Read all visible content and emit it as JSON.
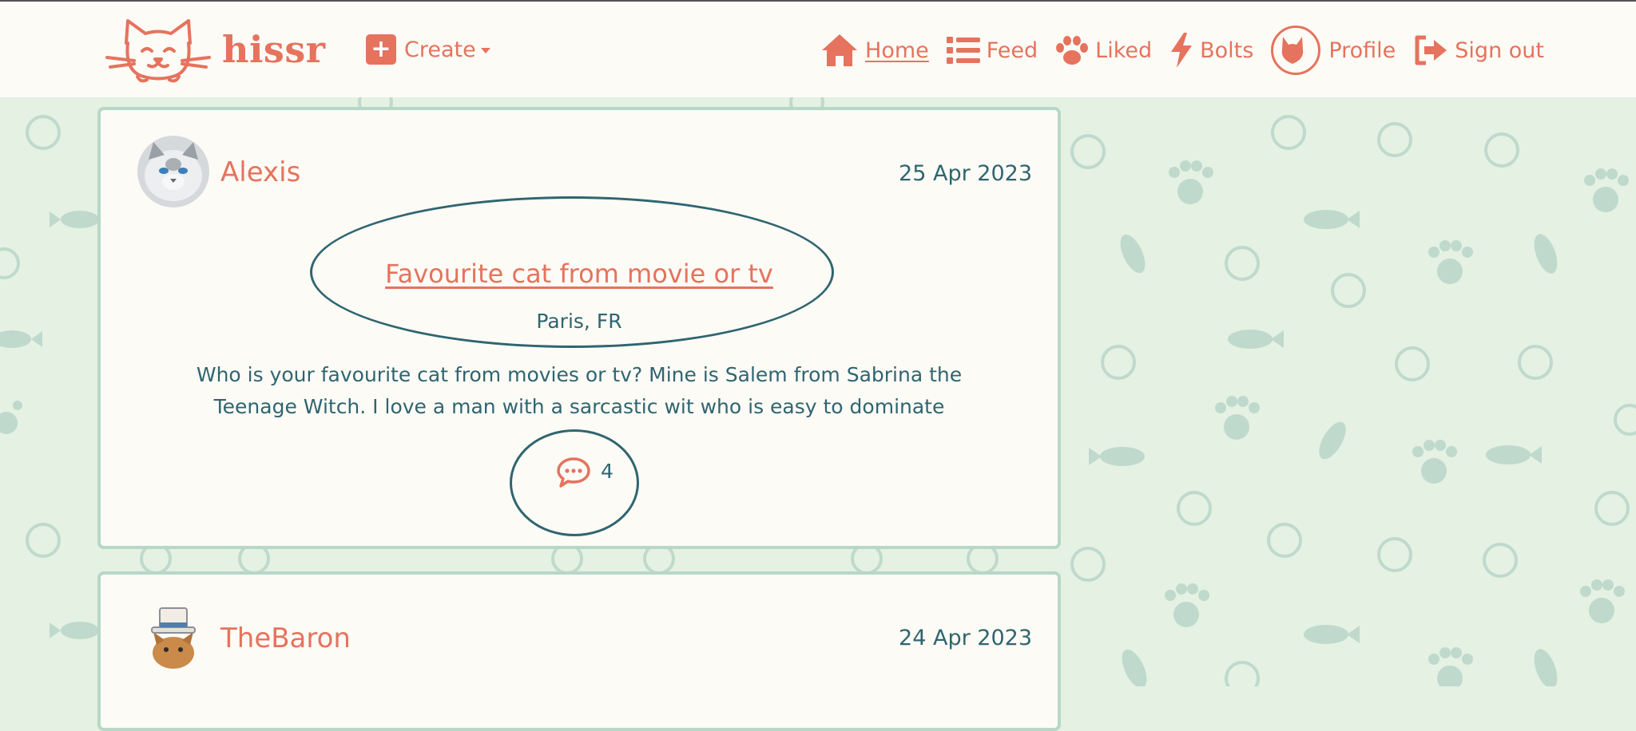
{
  "brand": {
    "name": "hissr",
    "logo_icon": "cat-face-logo"
  },
  "navbar": {
    "create_label": "Create",
    "items": [
      {
        "label": "Home",
        "icon": "home-icon",
        "active": true
      },
      {
        "label": "Feed",
        "icon": "list-icon"
      },
      {
        "label": "Liked",
        "icon": "paw-icon"
      },
      {
        "label": "Bolts",
        "icon": "bolt-icon"
      },
      {
        "label": "Profile",
        "icon": "cat-avatar-icon"
      },
      {
        "label": "Sign out",
        "icon": "sign-out-icon"
      }
    ]
  },
  "posts": [
    {
      "author": "Alexis",
      "date": "25 Apr 2023",
      "title": "Favourite cat from movie or tv",
      "location": "Paris, FR",
      "body": "Who is your favourite cat from movies or tv? Mine is Salem from Sabrina the Teenage Witch. I love a man with a sarcastic wit who is easy to dominate",
      "comment_count": "4"
    },
    {
      "author": "TheBaron",
      "date": "24 Apr 2023"
    }
  ],
  "colors": {
    "accent": "#e5735d",
    "text_teal": "#2f6570",
    "background": "#e4f1e3",
    "card_border": "#b7d8c6",
    "card_bg": "#fdfbf6"
  }
}
